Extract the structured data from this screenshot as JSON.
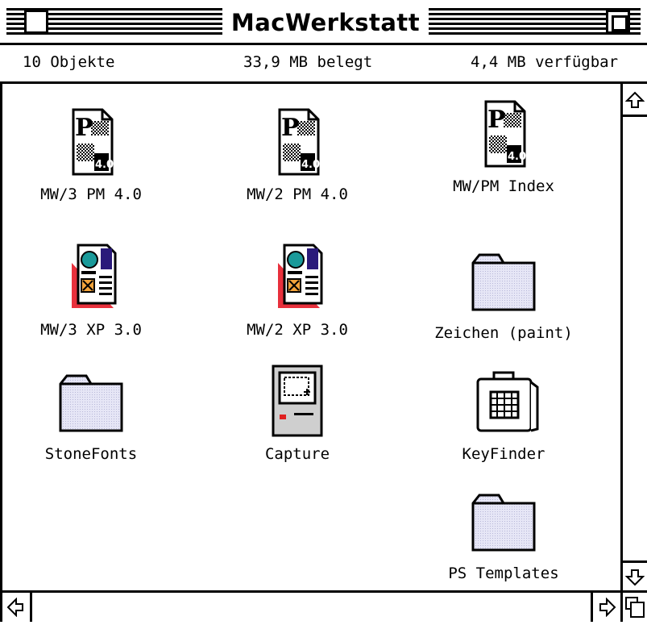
{
  "window": {
    "title": "MacWerkstatt"
  },
  "info": {
    "count": "10 Objekte",
    "used": "33,9 MB belegt",
    "free": "4,4 MB verfügbar"
  },
  "items": [
    {
      "label": "MW/3 PM 4.0",
      "icon": "pagemaker-doc-icon"
    },
    {
      "label": "MW/2 PM 4.0",
      "icon": "pagemaker-doc-icon"
    },
    {
      "label": "MW/PM Index",
      "icon": "pagemaker-doc-icon"
    },
    {
      "label": "MW/3 XP 3.0",
      "icon": "quarkxpress-doc-icon"
    },
    {
      "label": "MW/2 XP 3.0",
      "icon": "quarkxpress-doc-icon"
    },
    {
      "label": "Zeichen (paint)",
      "icon": "folder-icon"
    },
    {
      "label": "StoneFonts",
      "icon": "folder-icon"
    },
    {
      "label": "Capture",
      "icon": "macintosh-app-icon"
    },
    {
      "label": "KeyFinder",
      "icon": "keyfinder-app-icon"
    },
    {
      "label": "PS Templates",
      "icon": "folder-icon"
    }
  ],
  "badges": {
    "pm": "P",
    "version": "4.0"
  }
}
